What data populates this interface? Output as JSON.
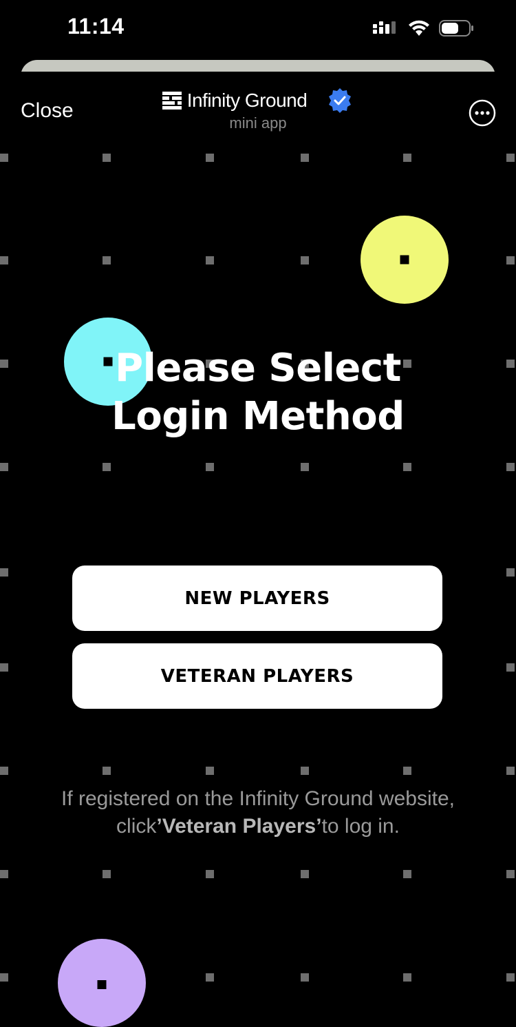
{
  "status_bar": {
    "time": "11:14"
  },
  "header": {
    "close_label": "Close",
    "brand_name": "Infinity Ground",
    "subtitle": "mini app",
    "verified_color": "#3b7cf0"
  },
  "main": {
    "title_line1": "Please Select",
    "title_line2": "Login Method",
    "buttons": {
      "new_players": "NEW PLAYERS",
      "veteran_players": "VETERAN PLAYERS"
    },
    "note": {
      "line1": "If registered on the Infinity Ground website,",
      "line2_prefix": "click",
      "line2_emphasis": "’Veteran Players’",
      "line2_suffix": "to log in."
    }
  },
  "decor": {
    "circle_colors": {
      "yellow": "#f0f878",
      "cyan": "#80f4f8",
      "purple": "#c8a8f8"
    },
    "grid_dot_color": "#6e6e6e"
  },
  "icons": {
    "signal": "cellular-signal-icon",
    "wifi": "wifi-icon",
    "battery": "battery-icon",
    "logo": "infinity-ground-logo-icon",
    "verified": "verified-badge-icon",
    "more": "more-options-icon"
  }
}
